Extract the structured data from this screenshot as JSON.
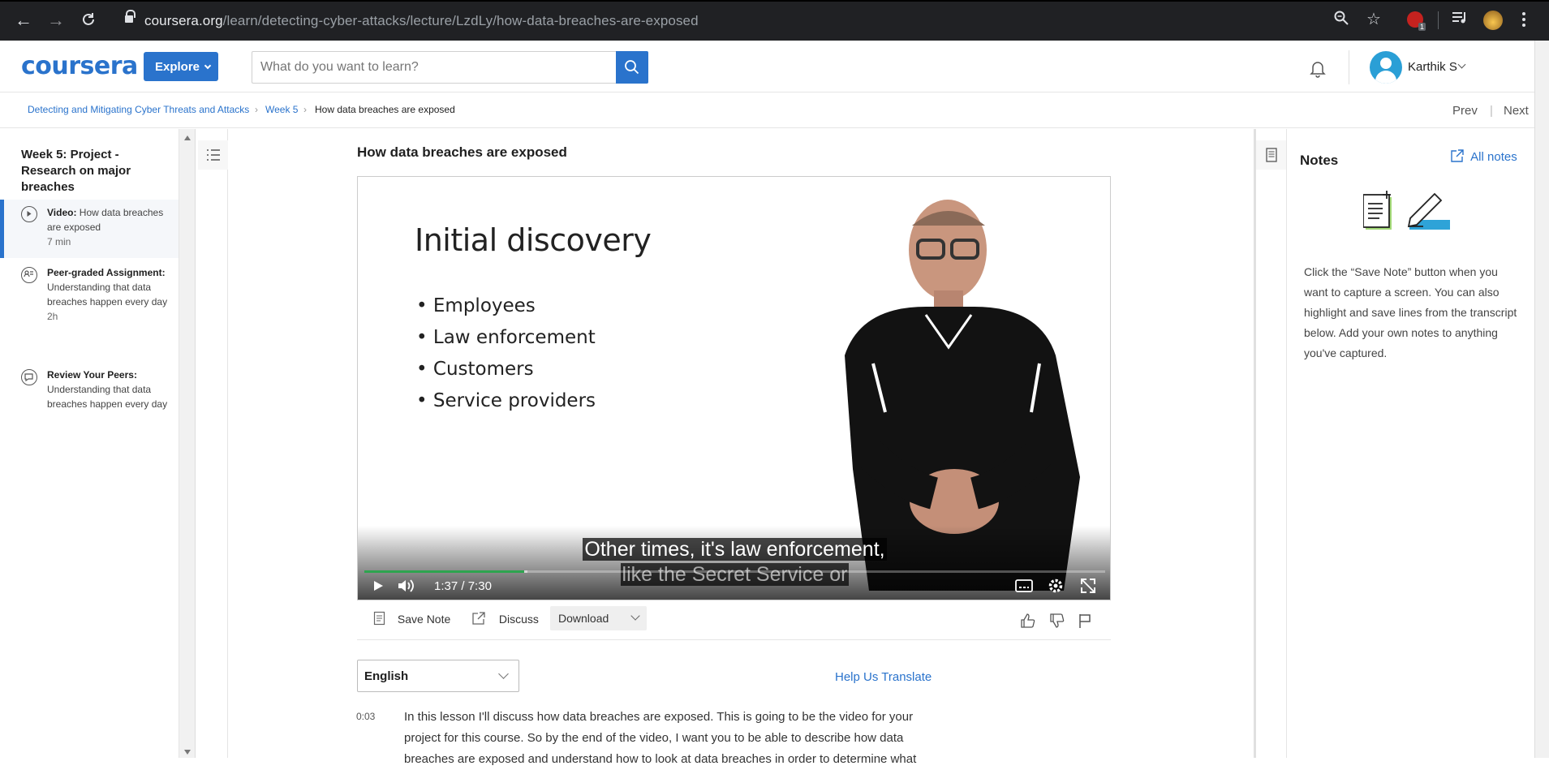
{
  "browser": {
    "url_host": "coursera.org",
    "url_path": "/learn/detecting-cyber-attacks/lecture/LzdLy/how-data-breaches-are-exposed",
    "extension_badge": "1"
  },
  "header": {
    "logo": "coursera",
    "explore_label": "Explore",
    "search_placeholder": "What do you want to learn?",
    "user_name": "Karthik S"
  },
  "breadcrumb": {
    "course": "Detecting and Mitigating Cyber Threats and Attacks",
    "week": "Week 5",
    "current": "How data breaches are exposed",
    "separator": "›",
    "prev_label": "Prev",
    "next_label": "Next",
    "divider": "|"
  },
  "sidebar": {
    "week_title": "Week 5: Project - Research on major breaches",
    "items": [
      {
        "type_label": "Video:",
        "title": "How data breaches are exposed",
        "meta": "7 min"
      },
      {
        "type_label": "Peer-graded Assignment:",
        "title": "Understanding that data breaches happen every day",
        "meta": "2h"
      },
      {
        "type_label": "Review Your Peers:",
        "title": "Understanding that data breaches happen every day",
        "meta": ""
      }
    ]
  },
  "lecture": {
    "title": "How data breaches are exposed",
    "slide_title": "Initial discovery",
    "slide_bullets": [
      "Employees",
      "Law enforcement",
      "Customers",
      "Service providers"
    ],
    "caption_line1": "Other times, it's law enforcement,",
    "caption_line2": "like the Secret Service or",
    "current_time": "1:37",
    "time_sep": "/",
    "duration": "7:30",
    "progress_fraction": 0.216,
    "buffered_fraction": 0.22
  },
  "actions": {
    "save_note": "Save Note",
    "discuss": "Discuss",
    "download": "Download"
  },
  "transcript": {
    "language": "English",
    "help_translate": "Help Us Translate",
    "timestamp": "0:03",
    "text": "In this lesson I'll discuss how data breaches are exposed. This is going to be the video for your project for this course. So by the end of the video, I want you to be able to describe how data breaches are exposed and understand how to look at data breaches in order to determine what"
  },
  "notes": {
    "title": "Notes",
    "all_notes": "All notes",
    "description": "Click the “Save Note” button when you want to capture a screen. You can also highlight and save lines from the transcript below. Add your own notes to anything you've captured."
  },
  "colors": {
    "brand": "#2a73cc",
    "progress": "#2ea44f",
    "chrome_bg": "#202124"
  }
}
